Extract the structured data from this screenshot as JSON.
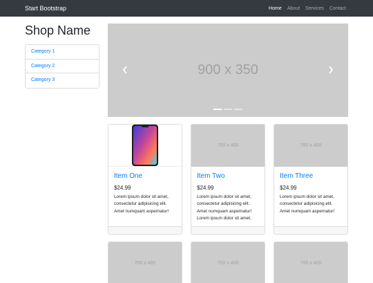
{
  "navbar": {
    "brand": "Start Bootstrap",
    "links": [
      {
        "label": "Home",
        "active": true
      },
      {
        "label": "About"
      },
      {
        "label": "Services"
      },
      {
        "label": "Contact"
      }
    ]
  },
  "sidebar": {
    "title": "Shop Name",
    "categories": [
      {
        "label": "Category 1"
      },
      {
        "label": "Category 2"
      },
      {
        "label": "Category 3"
      }
    ]
  },
  "carousel": {
    "placeholder": "900 x 350",
    "slides_count": 3,
    "active_slide": 1
  },
  "products": [
    {
      "image": "phone-image",
      "title": "Item One",
      "price": "$24.99",
      "description": "Lorem ipsum dolor sit amet, consectetur adipisicing elit. Amet numquam aspernatur!"
    },
    {
      "image": "700 x 400",
      "title": "Item Two",
      "price": "$24.99",
      "description": "Lorem ipsum dolor sit amet, consectetur adipisicing elit. Amet numquam aspernatur! Lorem ipsum dolor sit amet."
    },
    {
      "image": "700 x 400",
      "title": "Item Three",
      "price": "$24.99",
      "description": "Lorem ipsum dolor sit amet, consectetur adipisicing elit. Amet numquam aspernatur!"
    }
  ],
  "products_row2": [
    {
      "image": "700 x 400"
    },
    {
      "image": "700 x 400"
    },
    {
      "image": "700 x 400"
    }
  ],
  "colors": {
    "navbar_bg": "#343a40",
    "link": "#007bff",
    "placeholder_bg": "#cccccc"
  }
}
